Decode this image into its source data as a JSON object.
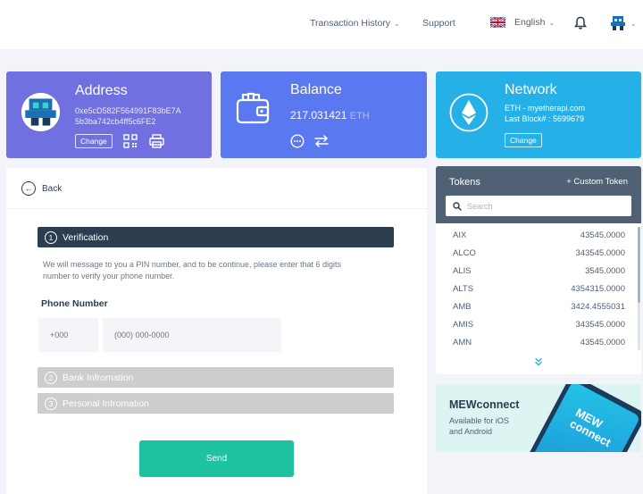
{
  "header": {
    "transaction_history": "Transaction History",
    "support": "Support",
    "language": "English"
  },
  "address_card": {
    "title": "Address",
    "address_line1": "0xe5cD582F564991F83bE7A",
    "address_line2": "5b3ba742cb4ff5c6FE2",
    "change_label": "Change"
  },
  "balance_card": {
    "title": "Balance",
    "amount": "217.031421",
    "unit": "ETH"
  },
  "network_card": {
    "title": "Network",
    "network_line": "ETH - myetherapi.com",
    "last_block": "Last Block# : 5699679",
    "change_label": "Change"
  },
  "main": {
    "back_label": "Back",
    "steps": [
      {
        "num": "1",
        "label": "Verification"
      },
      {
        "num": "2",
        "label": "Bank Infromation"
      },
      {
        "num": "3",
        "label": "Personal Infromation"
      }
    ],
    "description_line1": "We will message to you a PIN number, and to be continue, please enter that 6 digits",
    "description_line2": "number to verify your phone number.",
    "phone_label": "Phone Number",
    "country_code_placeholder": "+000",
    "phone_placeholder": "(000) 000-0000",
    "send_label": "Send"
  },
  "tokens": {
    "title": "Tokens",
    "custom_token": "+ Custom Token",
    "search_placeholder": "Search",
    "items": [
      {
        "symbol": "AIX",
        "amount": "43545.0000"
      },
      {
        "symbol": "ALCO",
        "amount": "343545.0000"
      },
      {
        "symbol": "ALIS",
        "amount": "3545.0000"
      },
      {
        "symbol": "ALTS",
        "amount": "4354315.0000"
      },
      {
        "symbol": "AMB",
        "amount": "3424.4555031"
      },
      {
        "symbol": "AMIS",
        "amount": "343545.0000"
      },
      {
        "symbol": "AMN",
        "amount": "43545.0000"
      }
    ]
  },
  "mewconnect": {
    "title": "MEWconnect",
    "subtitle_line1": "Available for iOS",
    "subtitle_line2": "and Android",
    "phone_text_line1": "MEW",
    "phone_text_line2": "connect"
  },
  "colors": {
    "address_card": "#7070e0",
    "balance_card": "#5a78f0",
    "network_card": "#25b0e8",
    "step_active": "#2c3d50",
    "step_inactive": "#cdcdcd",
    "send_button": "#1ec1a0",
    "tokens_header": "#506175"
  }
}
